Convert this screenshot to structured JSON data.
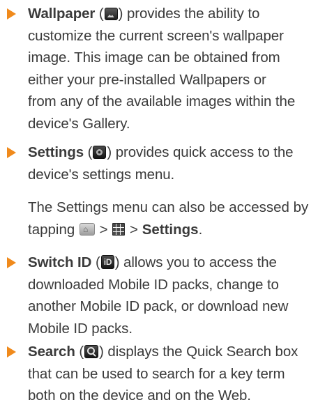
{
  "items": [
    {
      "bold": "Wallpaper",
      "open_paren": " (",
      "icon": "wallpaper-icon",
      "after_icon": ") provides the ability to",
      "lines": [
        "customize the current screen's wallpaper",
        "image. This image can be obtained from",
        "either your pre-installed Wallpapers or",
        "from any of the available images within the",
        "device's Gallery."
      ]
    },
    {
      "bold": "Settings",
      "open_paren": " (",
      "icon": "settings-icon",
      "after_icon": ") provides quick access to the",
      "lines": [
        "device's settings menu."
      ],
      "sub_line1": "The Settings menu can also be accessed by",
      "sub_tapping": "tapping ",
      "sub_sep1": " > ",
      "sub_sep2": " > ",
      "sub_bold": "Settings",
      "sub_end": "."
    },
    {
      "bold": "Switch ID",
      "open_paren": " (",
      "icon": "mobile-id-icon",
      "after_icon": ") allows you to access the",
      "lines": [
        "downloaded Mobile ID packs, change to",
        "another Mobile ID pack, or download new",
        "Mobile ID packs."
      ]
    },
    {
      "bold": "Search",
      "open_paren": " (",
      "icon": "search-icon",
      "after_icon": ") displays the Quick Search box",
      "lines": [
        "that can be used to search for a key term",
        "both on the device and on the Web."
      ]
    }
  ],
  "colors": {
    "bullet": "#f08a1c",
    "text": "#3b3b3b"
  }
}
